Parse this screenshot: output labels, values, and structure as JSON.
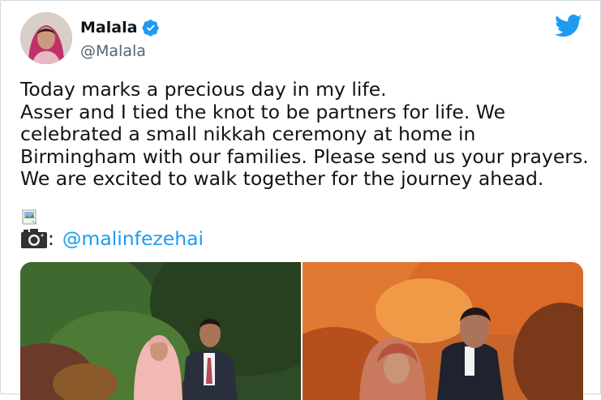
{
  "author": {
    "display_name": "Malala",
    "handle": "@Malala",
    "verified_icon": "verified-badge-icon",
    "avatar_icon": "avatar"
  },
  "brand": {
    "logo_icon": "twitter-bird-icon",
    "accent": "#1d9bf0"
  },
  "tweet": {
    "lines": [
      "Today marks a precious day in my life.",
      "Asser and I tied the knot to be partners for life. We",
      "celebrated a small nikkah ceremony at home in",
      "Birmingham with our families. Please send us your prayers.",
      "We are excited to walk together for the journey ahead."
    ],
    "credit_separator": ":",
    "credit_mention": "@malinfezehai",
    "camera_icon": "camera-icon",
    "broken_image_icon": "broken-image-icon"
  },
  "media": {
    "photos": [
      {
        "name": "photo-garden",
        "scene": "garden-greenery"
      },
      {
        "name": "photo-autumn",
        "scene": "autumn-leaves"
      }
    ]
  }
}
